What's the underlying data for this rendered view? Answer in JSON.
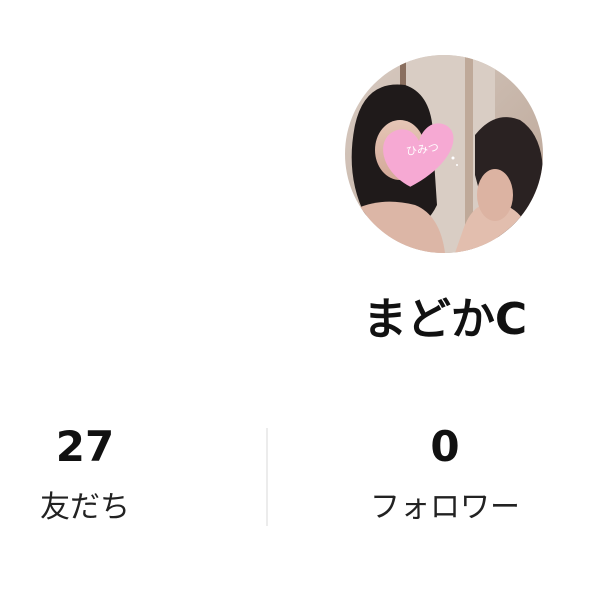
{
  "profile": {
    "avatar_sticker_text": "ひみつ",
    "username": "まどかC"
  },
  "stats": {
    "friends": {
      "count": "27",
      "label": "友だち"
    },
    "followers": {
      "count": "0",
      "label": "フォロワー"
    }
  }
}
